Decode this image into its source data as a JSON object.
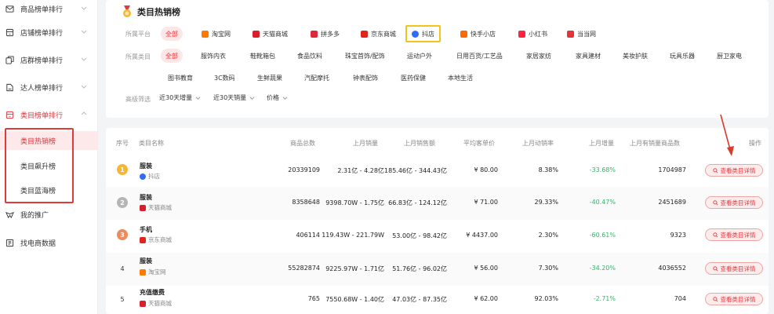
{
  "sidebar": {
    "items": [
      {
        "label": "商品榜单排行",
        "icon": "mail-icon"
      },
      {
        "label": "店铺榜单排行",
        "icon": "store-icon"
      },
      {
        "label": "店群榜单排行",
        "icon": "stores-icon"
      },
      {
        "label": "达人榜单排行",
        "icon": "person-icon"
      },
      {
        "label": "类目榜单排行",
        "icon": "store-icon"
      }
    ],
    "sub_items": [
      "类目热销榜",
      "类目飙升榜",
      "类目蓝海榜"
    ],
    "bottom_items": [
      {
        "label": "我的推广",
        "icon": "promo-icon"
      },
      {
        "label": "找电商数据",
        "icon": "data-icon"
      }
    ]
  },
  "header": {
    "title": "类目热销榜"
  },
  "filters": {
    "platform_label": "所属平台",
    "platforms": [
      "全部",
      "淘宝网",
      "天猫商城",
      "拼多多",
      "京东商城",
      "抖店",
      "快手小店",
      "小红书",
      "当当网"
    ],
    "category_label": "所属类目",
    "categories_row1": [
      "全部",
      "服饰内衣",
      "鞋靴箱包",
      "食品饮料",
      "珠宝首饰/配饰",
      "运动户外",
      "日用百货/工艺品",
      "家居家纺",
      "家具建材",
      "美妆护肤",
      "玩具乐器",
      "厨卫家电"
    ],
    "categories_row2": [
      "图书教育",
      "3C数码",
      "生鲜蔬果",
      "汽配摩托",
      "钟表配饰",
      "医药保健",
      "本地生活"
    ],
    "filter_label": "高级筛选",
    "selects": [
      "近30天增量",
      "近30天销量",
      "价格"
    ]
  },
  "table": {
    "headers": [
      "序号",
      "类目名称",
      "商品总数",
      "上月销量",
      "上月销售额",
      "平均客单价",
      "上月动销率",
      "上月增量",
      "上月有销量商品数",
      "操作"
    ],
    "action_label": "查看类目详情",
    "rows": [
      {
        "rank": "1",
        "name": "服装",
        "platform": "抖店",
        "total": "20339109",
        "sales": "2.31亿 - 4.28亿",
        "revenue": "185.46亿 - 344.43亿",
        "avg_price": "¥ 80.00",
        "rate": "8.38%",
        "growth": "-33.68%",
        "active": "1704987"
      },
      {
        "rank": "2",
        "name": "服装",
        "platform": "天猫商城",
        "total": "8358648",
        "sales": "9398.70W - 1.75亿",
        "revenue": "66.83亿 - 124.12亿",
        "avg_price": "¥ 71.00",
        "rate": "29.33%",
        "growth": "-40.47%",
        "active": "2451689"
      },
      {
        "rank": "3",
        "name": "手机",
        "platform": "京东商城",
        "total": "406114",
        "sales": "119.43W - 221.79W",
        "revenue": "53.00亿 - 98.42亿",
        "avg_price": "¥ 4437.00",
        "rate": "2.30%",
        "growth": "-60.61%",
        "active": "9323"
      },
      {
        "rank": "4",
        "name": "服装",
        "platform": "淘宝网",
        "total": "55282874",
        "sales": "9225.97W - 1.71亿",
        "revenue": "51.76亿 - 96.02亿",
        "avg_price": "¥ 56.00",
        "rate": "7.30%",
        "growth": "-34.20%",
        "active": "4036552"
      },
      {
        "rank": "5",
        "name": "充值缴费",
        "platform": "天猫商城",
        "total": "765",
        "sales": "7550.68W - 1.40亿",
        "revenue": "47.03亿 - 87.35亿",
        "avg_price": "¥ 62.00",
        "rate": "92.03%",
        "growth": "-2.71%",
        "active": "704"
      }
    ]
  },
  "colors": {
    "accent": "#e0383e",
    "green": "#3ab26b",
    "gold": "#f5b731"
  }
}
